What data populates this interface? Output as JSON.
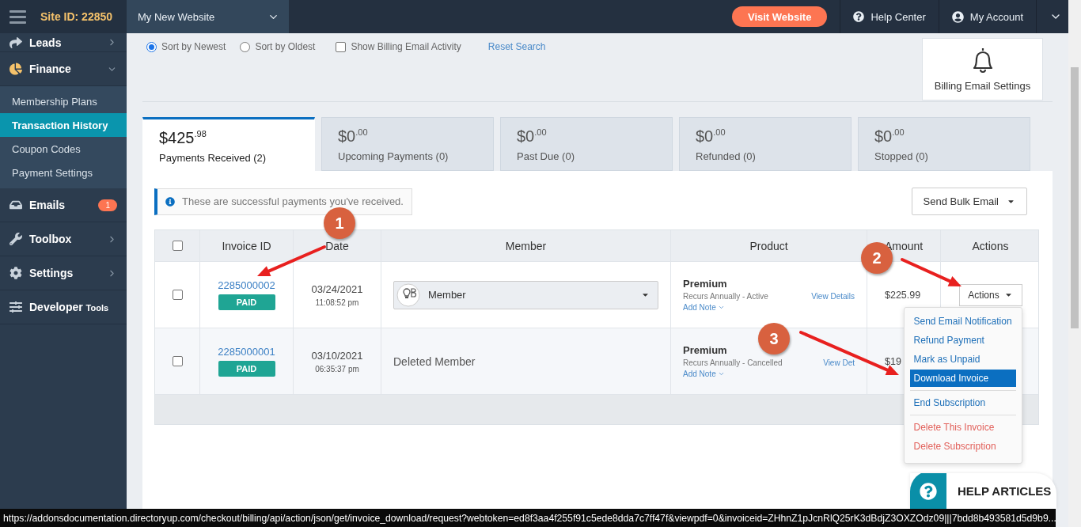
{
  "topbar": {
    "site_id": "Site ID: 22850",
    "website_select": "My New Website",
    "visit_button": "Visit Website",
    "help_link": "Help Center",
    "account_link": "My Account"
  },
  "sidebar": {
    "items": [
      {
        "label": "Leads",
        "kind": "group",
        "expanded": false
      },
      {
        "label": "Finance",
        "kind": "group",
        "expanded": true,
        "children": [
          {
            "label": "Membership Plans",
            "selected": false
          },
          {
            "label": "Transaction History",
            "selected": true
          },
          {
            "label": "Coupon Codes",
            "selected": false
          },
          {
            "label": "Payment Settings",
            "selected": false
          }
        ]
      },
      {
        "label": "Emails",
        "kind": "link",
        "badge": "1"
      },
      {
        "label": "Toolbox",
        "kind": "group",
        "expanded": false
      },
      {
        "label": "Settings",
        "kind": "group",
        "expanded": false
      },
      {
        "label": "Developer",
        "kind": "link",
        "suffix": "Tools"
      }
    ]
  },
  "filters": {
    "sort_options": [
      {
        "label": "Sort by Newest",
        "selected": true
      },
      {
        "label": "Sort by Oldest",
        "selected": false
      }
    ],
    "activity_checkbox": {
      "label": "Show Billing Email Activity",
      "checked": false
    },
    "reset_link": "Reset Search"
  },
  "billing_settings_button": "Billing Email Settings",
  "tabs": [
    {
      "amount": "$425",
      "cents": ".98",
      "label": "Payments Received (2)",
      "selected": true
    },
    {
      "amount": "$0",
      "cents": ".00",
      "label": "Upcoming Payments (0)",
      "selected": false
    },
    {
      "amount": "$0",
      "cents": ".00",
      "label": "Past Due (0)",
      "selected": false
    },
    {
      "amount": "$0",
      "cents": ".00",
      "label": "Refunded (0)",
      "selected": false
    },
    {
      "amount": "$0",
      "cents": ".00",
      "label": "Stopped (0)",
      "selected": false
    }
  ],
  "info_alert": "These are successful payments you've received.",
  "bulk_email_button": "Send Bulk Email",
  "table": {
    "header_checked": false,
    "columns": [
      "Invoice ID",
      "Date",
      "Member",
      "Product",
      "Amount",
      "Actions"
    ],
    "rows": [
      {
        "checked": false,
        "invoice": "2285000002",
        "status": "PAID",
        "date": "03/24/2021",
        "time": "11:08:52 pm",
        "member": {
          "kind": "select",
          "label": "Member"
        },
        "product": {
          "name": "Premium",
          "recurrence": "Recurs Annually - Active",
          "details_link": "View Details",
          "note_link": "Add Note"
        },
        "amount": "$225.99",
        "actions_button": "Actions",
        "actions_menu": [
          {
            "items": [
              {
                "label": "Send Email Notification",
                "kind": "normal",
                "selected": false
              },
              {
                "label": "Refund Payment",
                "kind": "normal",
                "selected": false
              },
              {
                "label": "Mark as Unpaid",
                "kind": "normal",
                "selected": false
              },
              {
                "label": "Download Invoice",
                "kind": "normal",
                "selected": true
              }
            ]
          },
          {
            "items": [
              {
                "label": "End Subscription",
                "kind": "normal",
                "selected": false
              }
            ]
          },
          {
            "items": [
              {
                "label": "Delete This Invoice",
                "kind": "danger",
                "selected": false
              },
              {
                "label": "Delete Subscription",
                "kind": "danger",
                "selected": false
              }
            ]
          }
        ]
      },
      {
        "checked": false,
        "invoice": "2285000001",
        "status": "PAID",
        "date": "03/10/2021",
        "time": "06:35:37 pm",
        "member": {
          "kind": "text",
          "label": "Deleted Member"
        },
        "product": {
          "name": "Premium",
          "recurrence": "Recurs Annually - Cancelled",
          "details_link": "View Det",
          "note_link": "Add Note"
        },
        "amount": "$19"
      }
    ]
  },
  "annotations": [
    {
      "number": "1"
    },
    {
      "number": "2"
    },
    {
      "number": "3"
    }
  ],
  "help_widget": "HELP ARTICLES",
  "status_url": "https://addonsdocumentation.directoryup.com/checkout/billing/api/action/json/get/invoice_download/request?webtoken=ed8f3aa4f255f91c5ede8dda7c7ff47f&viewpdf=0&invoiceid=ZHhnZ1pJcnRlQ25rK3dBdjZ3OXZOdz09|||7bdd8b493581d5d9b9..."
}
